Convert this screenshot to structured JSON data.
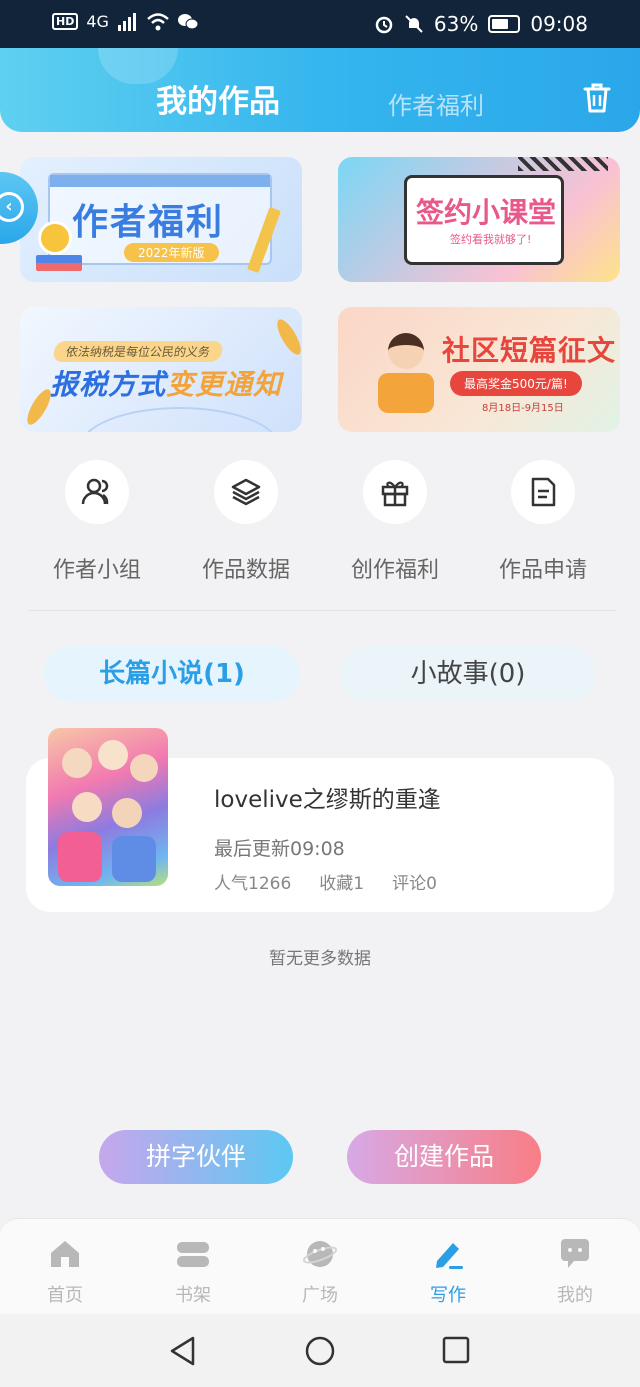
{
  "status_bar": {
    "network": "4G",
    "battery": "63%",
    "time": "09:08"
  },
  "header": {
    "tab_active": "我的作品",
    "tab_inactive": "作者福利",
    "trash_icon": "trash-icon"
  },
  "banners": [
    {
      "title": "作者福利",
      "subtitle": "2022年新版"
    },
    {
      "title": "签约小课堂",
      "subtitle": "签约看我就够了!"
    },
    {
      "pill": "依法纳税是每位公民的义务",
      "title_a": "报税方式",
      "title_b": "变更通知"
    },
    {
      "title": "社区短篇征文",
      "prize": "最高奖金500元/篇!",
      "date": "8月18日-9月15日"
    }
  ],
  "quick_actions": [
    {
      "label": "作者小组",
      "icon": "users-icon"
    },
    {
      "label": "作品数据",
      "icon": "layers-icon"
    },
    {
      "label": "创作福利",
      "icon": "gift-icon"
    },
    {
      "label": "作品申请",
      "icon": "document-icon"
    }
  ],
  "category_tabs": {
    "long": "长篇小说(1)",
    "short": "小故事(0)"
  },
  "work": {
    "title": "lovelive之缪斯的重逢",
    "updated": "最后更新09:08",
    "popularity": "人气1266",
    "favorites": "收藏1",
    "comments": "评论0"
  },
  "no_more": "暂无更多数据",
  "actions": {
    "partner": "拼字伙伴",
    "create": "创建作品"
  },
  "bottom_nav": [
    {
      "label": "首页",
      "icon": "home-icon"
    },
    {
      "label": "书架",
      "icon": "bookshelf-icon"
    },
    {
      "label": "广场",
      "icon": "planet-icon"
    },
    {
      "label": "写作",
      "icon": "pen-icon",
      "active": true
    },
    {
      "label": "我的",
      "icon": "chat-bubble-icon"
    }
  ],
  "colors": {
    "accent": "#2b9fe6",
    "header_start": "#5fd0f0",
    "header_end": "#2aa7ea",
    "create_start": "#d7a9e6",
    "create_end": "#f87e86"
  }
}
